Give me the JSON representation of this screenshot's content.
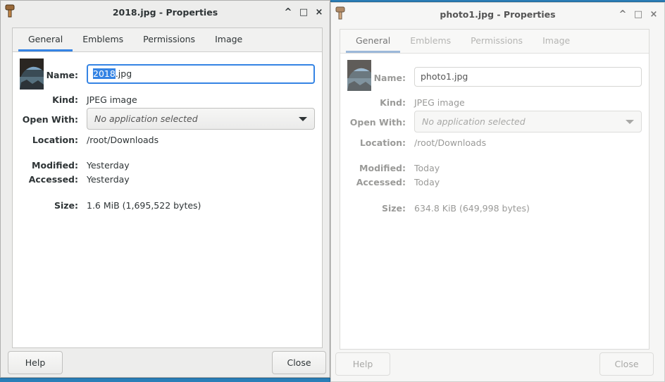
{
  "windows": [
    {
      "title": "2018.jpg - Properties",
      "controls": {
        "minimize": "^",
        "maximize": "□",
        "close": "×"
      },
      "tabs": [
        "General",
        "Emblems",
        "Permissions",
        "Image"
      ],
      "active_tab": "General",
      "labels": {
        "name": "Name:",
        "kind": "Kind:",
        "open_with": "Open With:",
        "location": "Location:",
        "modified": "Modified:",
        "accessed": "Accessed:",
        "size": "Size:"
      },
      "name_selected": "2018",
      "name_rest": ".jpg",
      "kind": "JPEG image",
      "open_with": "No application selected",
      "location": "/root/Downloads",
      "modified": "Yesterday",
      "accessed": "Yesterday",
      "size": "1.6 MiB (1,695,522 bytes)",
      "buttons": {
        "help": "Help",
        "close": "Close"
      }
    },
    {
      "title": "photo1.jpg - Properties",
      "controls": {
        "minimize": "^",
        "maximize": "□",
        "close": "×"
      },
      "tabs": [
        "General",
        "Emblems",
        "Permissions",
        "Image"
      ],
      "active_tab": "General",
      "labels": {
        "name": "Name:",
        "kind": "Kind:",
        "open_with": "Open With:",
        "location": "Location:",
        "modified": "Modified:",
        "accessed": "Accessed:",
        "size": "Size:"
      },
      "name": "photo1.jpg",
      "kind": "JPEG image",
      "open_with": "No application selected",
      "location": "/root/Downloads",
      "modified": "Today",
      "accessed": "Today",
      "size": "634.8 KiB (649,998 bytes)",
      "buttons": {
        "help": "Help",
        "close": "Close"
      }
    }
  ],
  "colors": {
    "accent": "#3584e4",
    "desktop": "#2a7fb8"
  },
  "icons": {
    "app": "properties-app-icon",
    "thumbnail": "image-thumbnail"
  }
}
